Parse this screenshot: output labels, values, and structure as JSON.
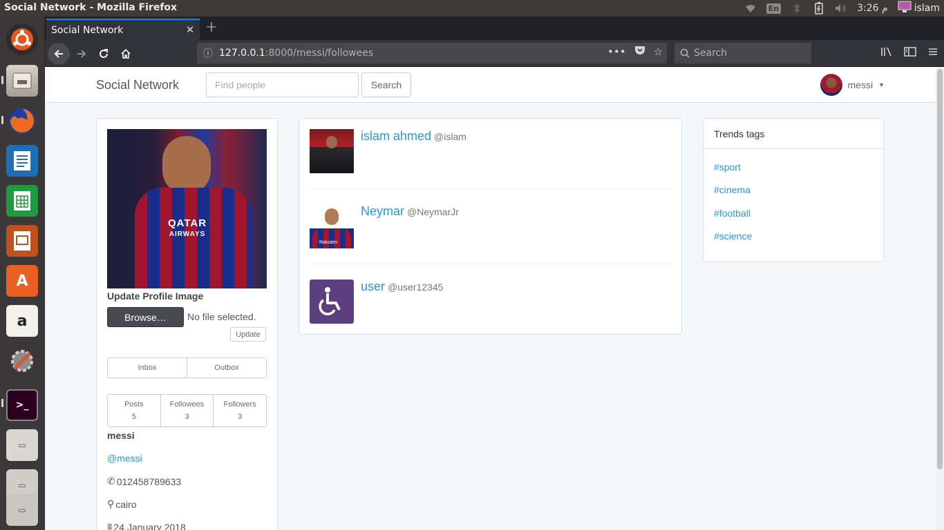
{
  "os": {
    "window_title": "Social Network - Mozilla Firefox",
    "keyboard_layout": "En",
    "clock": "3:26 م",
    "user": "islam"
  },
  "browser": {
    "tab_title": "Social Network",
    "url_host": "127.0.0.1",
    "url_path": ":8000/messi/followees",
    "search_placeholder": "Search",
    "accent": "#0a84ff"
  },
  "site": {
    "brand": "Social Network",
    "find_placeholder": "Find people",
    "search_button": "Search",
    "current_user": "messi",
    "link_color": "#3097d1"
  },
  "profile": {
    "update_title": "Update Profile Image",
    "browse_label": "Browse…",
    "no_file": "No file selected.",
    "update_button": "Update",
    "inbox": "Inbox",
    "outbox": "Outbox",
    "stats": [
      {
        "label": "Posts",
        "value": "5"
      },
      {
        "label": "Followees",
        "value": "3"
      },
      {
        "label": "Followers",
        "value": "3"
      }
    ],
    "name": "messi",
    "handle": "@messi",
    "phone": "012458789633",
    "city": "cairo",
    "joined": "24 January 2018",
    "sponsor_line1": "QATAR",
    "sponsor_line2": "AIRWAYS"
  },
  "followees": [
    {
      "name": "islam ahmed",
      "handle": "@islam"
    },
    {
      "name": "Neymar",
      "handle": "@NeymarJr",
      "shirt_text": "Rakuten"
    },
    {
      "name": "user",
      "handle": "@user12345"
    }
  ],
  "trends": {
    "title": "Trends tags",
    "tags": [
      "#sport",
      "#cinema",
      "#football",
      "#science"
    ]
  }
}
